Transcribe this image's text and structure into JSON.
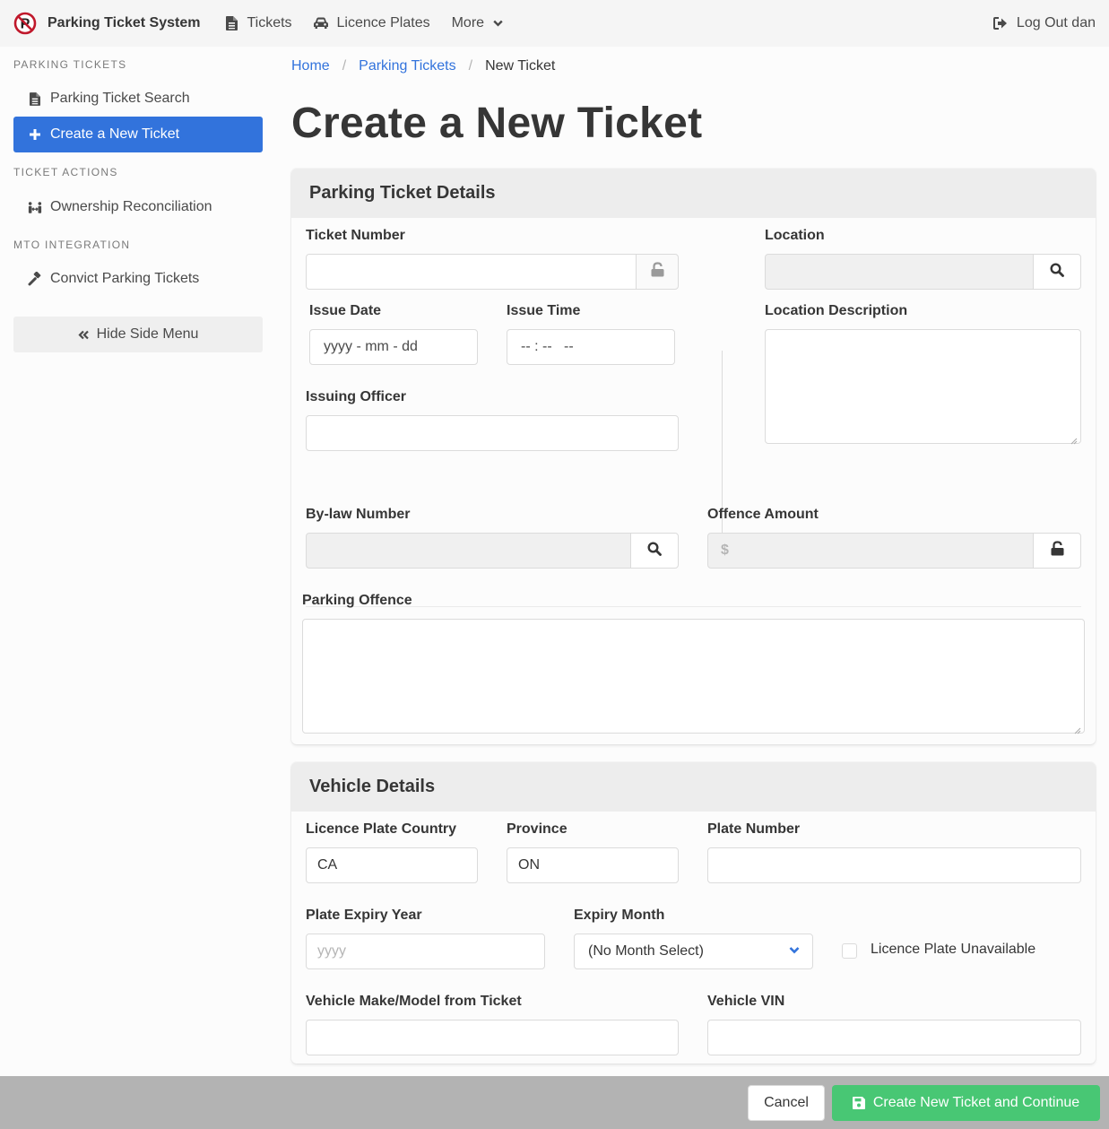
{
  "navbar": {
    "brand_title": "Parking Ticket System",
    "brand_icon": "no-parking-icon",
    "items": [
      {
        "label": "Tickets",
        "icon": "file-icon"
      },
      {
        "label": "Licence Plates",
        "icon": "car-icon"
      },
      {
        "label": "More",
        "icon": "chevron-down-icon"
      }
    ],
    "logout_label": "Log Out dan",
    "logout_icon": "sign-out-icon"
  },
  "sidebar": {
    "sections": [
      {
        "label": "Parking Tickets",
        "items": [
          {
            "label": "Parking Ticket Search",
            "icon": "file-icon",
            "active": false
          },
          {
            "label": "Create a New Ticket",
            "icon": "plus-icon",
            "active": true
          }
        ]
      },
      {
        "label": "Ticket Actions",
        "items": [
          {
            "label": "Ownership Reconciliation",
            "icon": "people-arrows-icon",
            "active": false
          }
        ]
      },
      {
        "label": "MTO Integration",
        "items": [
          {
            "label": "Convict Parking Tickets",
            "icon": "gavel-icon",
            "active": false
          }
        ]
      }
    ],
    "hide_label": "Hide Side Menu",
    "hide_icon": "double-chevron-left-icon"
  },
  "breadcrumb": [
    {
      "label": "Home",
      "link": true
    },
    {
      "label": "Parking Tickets",
      "link": true
    },
    {
      "label": "New Ticket",
      "link": false
    }
  ],
  "page_title": "Create a New Ticket",
  "ticket_details": {
    "title": "Parking Ticket Details",
    "ticket_number": {
      "label": "Ticket Number",
      "value": "",
      "addon_icon": "unlock-icon"
    },
    "issue_date": {
      "label": "Issue Date",
      "placeholder": "yyyy - mm - dd"
    },
    "issue_time": {
      "label": "Issue Time",
      "placeholder": "-- : --   --"
    },
    "issuing_officer": {
      "label": "Issuing Officer",
      "value": ""
    },
    "location": {
      "label": "Location",
      "value": "",
      "addon_icon": "search-icon"
    },
    "location_description": {
      "label": "Location Description",
      "value": ""
    },
    "bylaw_number": {
      "label": "By-law Number",
      "value": "",
      "addon_icon": "search-icon"
    },
    "offence_amount": {
      "label": "Offence Amount",
      "placeholder": "$",
      "addon_icon": "unlock-icon"
    },
    "parking_offence": {
      "label": "Parking Offence",
      "value": ""
    }
  },
  "vehicle_details": {
    "title": "Vehicle Details",
    "country": {
      "label": "Licence Plate Country",
      "value": "CA"
    },
    "province": {
      "label": "Province",
      "value": "ON"
    },
    "plate_number": {
      "label": "Plate Number",
      "value": ""
    },
    "expiry_year": {
      "label": "Plate Expiry Year",
      "placeholder": "yyyy"
    },
    "expiry_month": {
      "label": "Expiry Month",
      "selected": "(No Month Select)"
    },
    "plate_unavailable": {
      "label": "Licence Plate Unavailable",
      "checked": false
    },
    "make_model": {
      "label": "Vehicle Make/Model from Ticket",
      "value": ""
    },
    "vin": {
      "label": "Vehicle VIN",
      "value": ""
    }
  },
  "footer": {
    "cancel_label": "Cancel",
    "create_label": "Create New Ticket and Continue",
    "create_icon": "save-icon"
  },
  "colors": {
    "primary": "#3273dc",
    "success": "#48c774",
    "no_parking_red": "#c0182b"
  }
}
